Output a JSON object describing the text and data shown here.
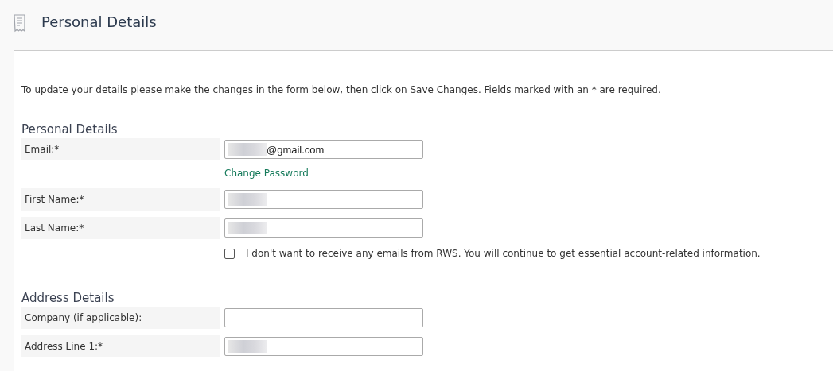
{
  "header": {
    "title": "Personal Details"
  },
  "intro": "To update your details please make the changes in the form below, then click on Save Changes. Fields marked with an * are required.",
  "sections": [
    {
      "heading": "Personal Details",
      "rows": [
        {
          "kind": "field",
          "label": "Email:*",
          "value": "@gmail.com",
          "redacted": true
        },
        {
          "kind": "link",
          "text": "Change Password"
        },
        {
          "kind": "field",
          "label": "First Name:*",
          "redacted": true
        },
        {
          "kind": "field",
          "label": "Last Name:*",
          "redacted": true
        },
        {
          "kind": "checkbox",
          "text": "I don't want to receive any emails from RWS. You will continue to get essential account-related information.",
          "checked": false
        }
      ]
    },
    {
      "heading": "Address Details",
      "rows": [
        {
          "kind": "field",
          "label": "Company (if applicable):",
          "redacted": false
        },
        {
          "kind": "field",
          "label": "Address Line 1:*",
          "redacted": true
        }
      ]
    }
  ]
}
